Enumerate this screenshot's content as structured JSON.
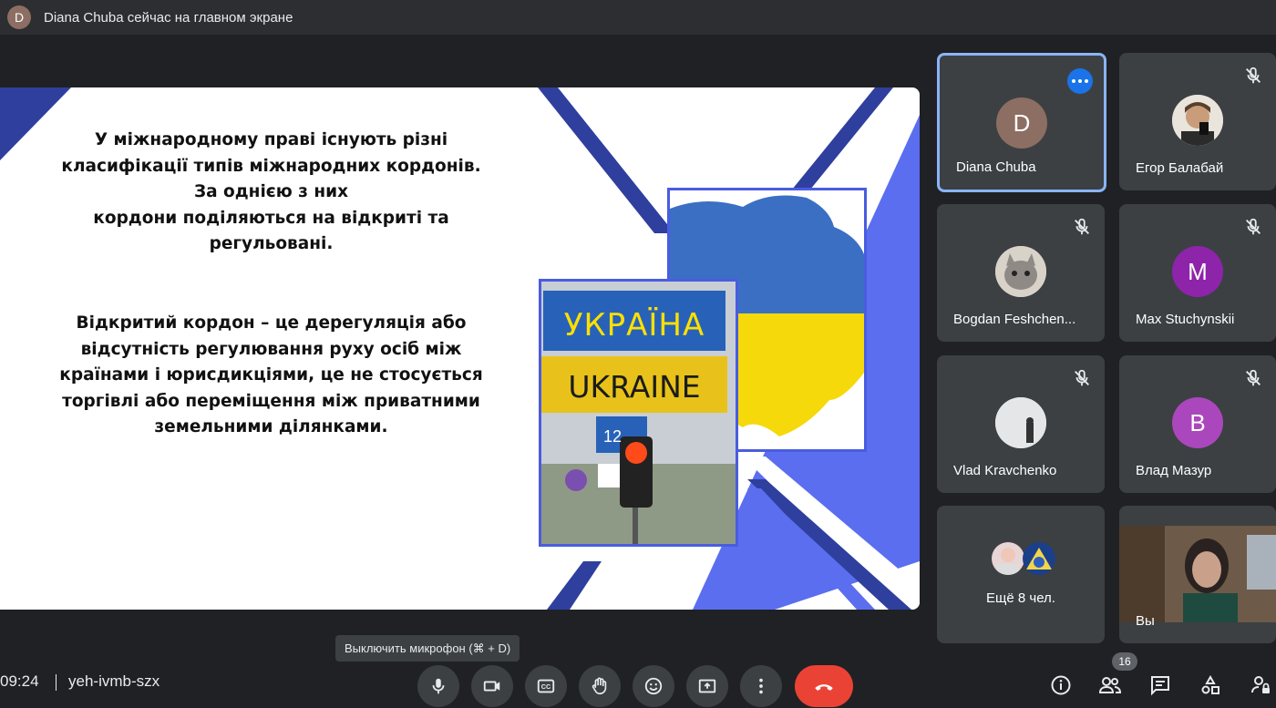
{
  "topbar": {
    "avatar_letter": "D",
    "text": "Diana Chuba сейчас на главном экране"
  },
  "slide": {
    "para1": [
      "У міжнародному праві існують різні",
      "класифікації типів міжнародних кордонів.",
      "За однією з них",
      "кордони поділяються на відкриті та",
      "регульовані."
    ],
    "para2": [
      "Відкритий кордон – це дерегуляція або",
      "відсутність регулювання руху осіб між",
      "країнами і юрисдикціями, це не стосується",
      "торгівлі або переміщення між приватними",
      "земельними ділянками."
    ],
    "sign_ua": "УКРАЇНА",
    "sign_en": "UKRAINE",
    "road_number": "12"
  },
  "participants": [
    {
      "name": "Diana Chuba",
      "avatar": "D",
      "color": "#8d6e63"
    },
    {
      "name": "Егор Балабай",
      "avatar": "photo"
    },
    {
      "name": "Bogdan Feshchen...",
      "avatar": "photo"
    },
    {
      "name": "Max Stuchynskii",
      "avatar": "M",
      "color": "#8e24aa"
    },
    {
      "name": "Vlad Kravchenko",
      "avatar": "photo"
    },
    {
      "name": "Влад Мазур",
      "avatar": "B",
      "color": "#ab47bc"
    },
    {
      "name": "Ещё 8 чел.",
      "avatar": "group"
    },
    {
      "name": "Вы",
      "avatar": "camera"
    }
  ],
  "tooltip": "Выключить микрофон (⌘ + D)",
  "bottombar": {
    "time": "09:24",
    "meeting_code": "yeh-ivmb-szx",
    "people_count": "16",
    "controls": [
      "mic-icon",
      "camera-icon",
      "captions-icon",
      "raise-hand-icon",
      "emoji-icon",
      "present-icon",
      "more-icon",
      "end-call-icon"
    ],
    "right_icons": [
      "info-icon",
      "people-icon",
      "chat-icon",
      "activities-icon",
      "host-controls-icon"
    ]
  },
  "colors": {
    "accent_blue": "#1a73e8",
    "end_call": "#ea4335",
    "slide_blue": "#4a5ce0",
    "flag_yellow": "#f5d90a",
    "flag_blue": "#3b6fc4"
  }
}
